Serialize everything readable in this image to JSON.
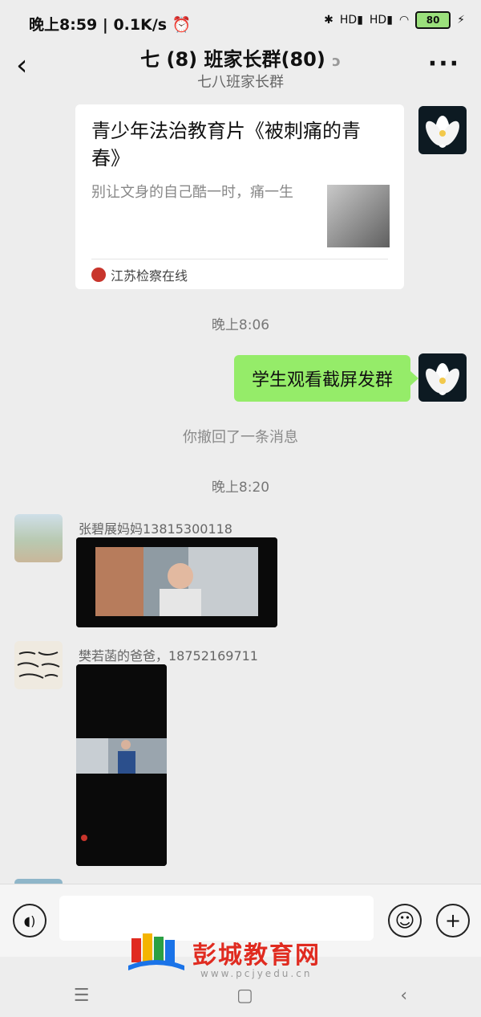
{
  "status_bar": {
    "time": "晚上8:59",
    "speed": "0.1K/s",
    "battery": "80",
    "hd1": "HD",
    "hd2": "HD"
  },
  "header": {
    "title": "七 (8) 班家长群(80)",
    "subtitle": "七八班家长群"
  },
  "card": {
    "title": "青少年法治教育片《被刺痛的青春》",
    "description": "别让文身的自己酷一时，痛一生",
    "source": "江苏检察在线"
  },
  "messages": {
    "time1": "晚上8:06",
    "sent_text": "学生观看截屏发群",
    "recall": "你撤回了一条消息",
    "time2": "晚上8:20",
    "sender1": "张碧展妈妈13815300118",
    "sender2": "樊若菡的爸爸，18752169711"
  },
  "watermark": {
    "text": "彭城教育网",
    "url": "www.pcjyedu.cn"
  },
  "colors": {
    "bubble_green": "#95ec69",
    "background": "#ededed"
  }
}
